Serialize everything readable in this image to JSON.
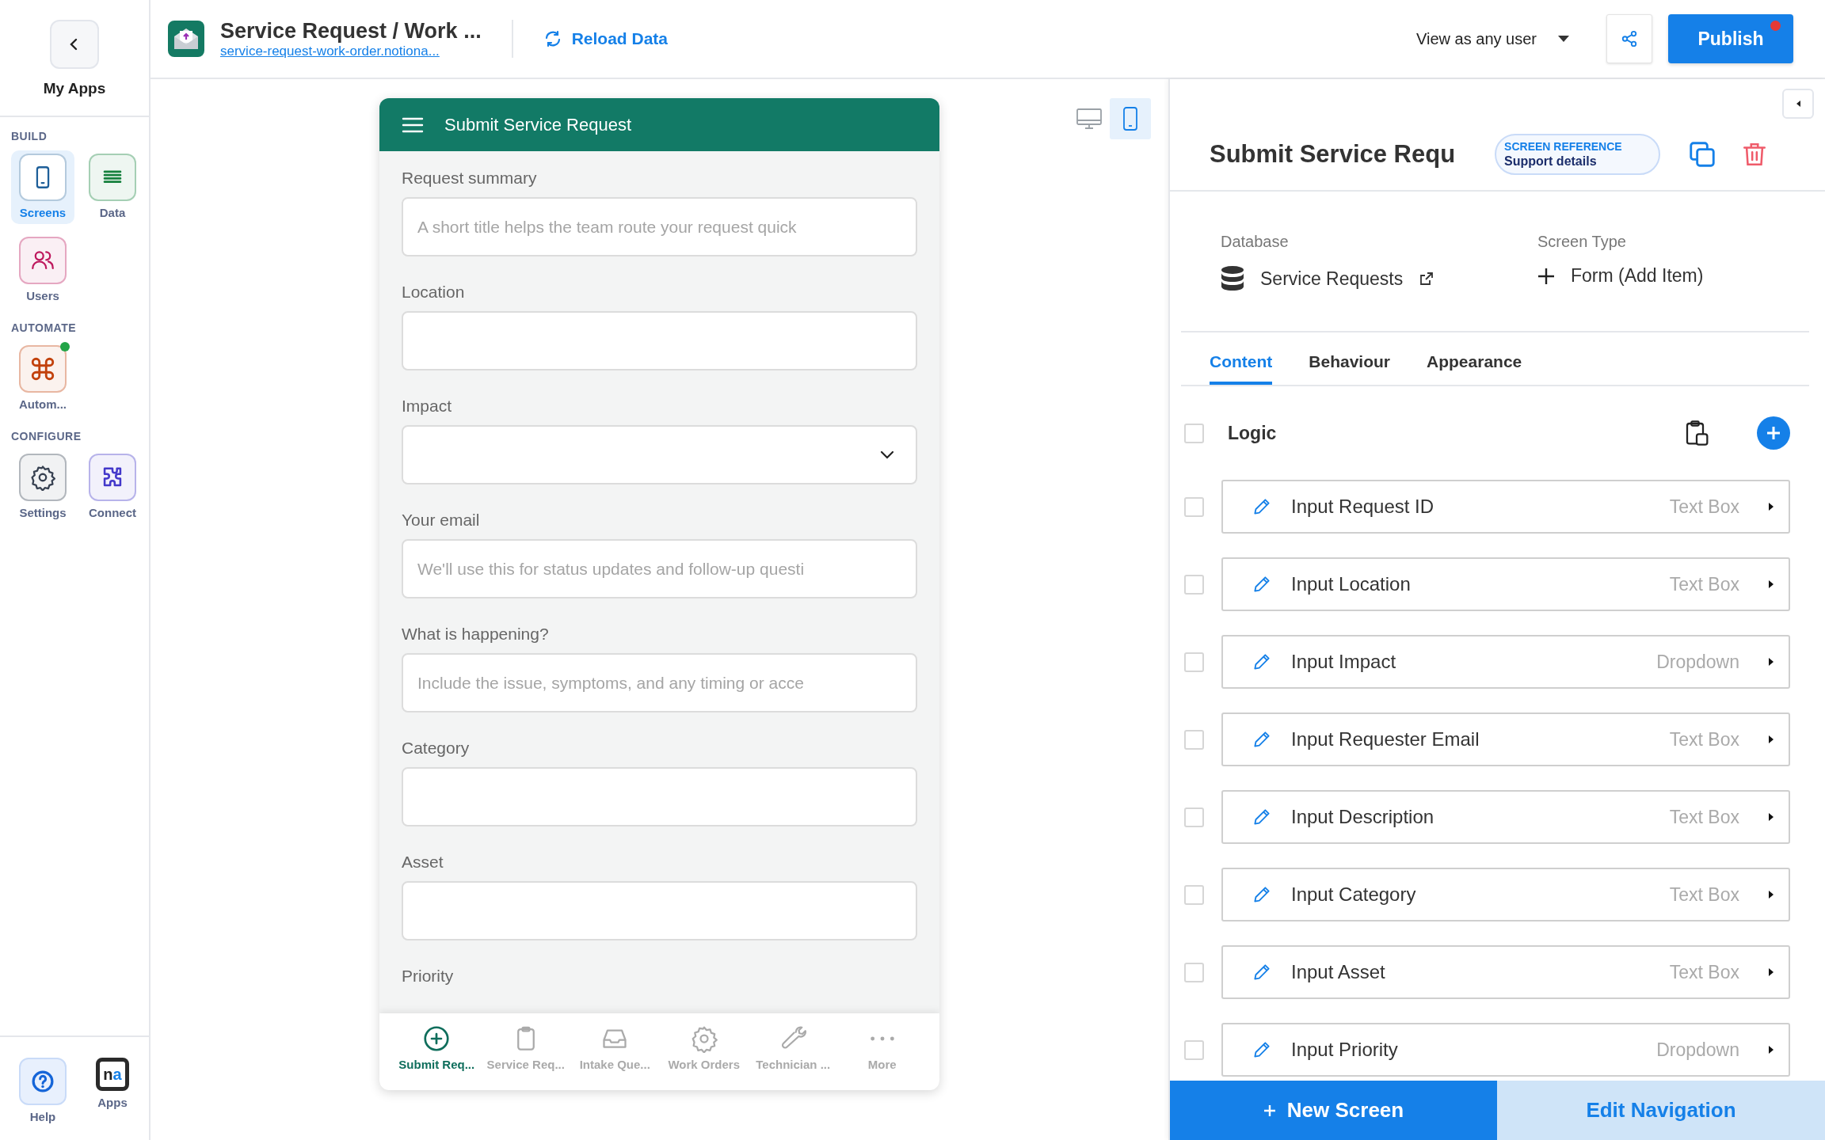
{
  "sidebar": {
    "back_label": "My Apps",
    "sections": [
      {
        "title": "BUILD",
        "items": [
          {
            "label": "Screens",
            "kind": "screens",
            "color": "#1e5f99",
            "selected": true,
            "notification": false
          },
          {
            "label": "Data",
            "kind": "data",
            "color": "#15803d",
            "selected": false,
            "notification": false
          },
          {
            "label": "Users",
            "kind": "users",
            "color": "#be185d",
            "selected": false,
            "notification": false
          }
        ]
      },
      {
        "title": "AUTOMATE",
        "items": [
          {
            "label": "Autom...",
            "kind": "automations",
            "color": "#c2410c",
            "selected": false,
            "notification": true
          }
        ]
      },
      {
        "title": "CONFIGURE",
        "items": [
          {
            "label": "Settings",
            "kind": "settings",
            "color": "#374151",
            "selected": false,
            "notification": false
          },
          {
            "label": "Connect",
            "kind": "connect",
            "color": "#4338ca",
            "selected": false,
            "notification": false
          }
        ]
      }
    ],
    "footer": [
      {
        "label": "Help",
        "kind": "help"
      },
      {
        "label": "Apps",
        "kind": "apps",
        "logo_text": "na"
      }
    ]
  },
  "top_bar": {
    "app_title": "Service Request / Work ...",
    "app_url": "service-request-work-order.notiona...",
    "reload": "Reload Data",
    "view_as": "View as any user",
    "publish": "Publish",
    "unpublished_changes": true
  },
  "canvas": {
    "devices": [
      {
        "kind": "desktop",
        "selected": false
      },
      {
        "kind": "mobile",
        "selected": true
      }
    ],
    "phone": {
      "title": "Submit Service Request",
      "fields": [
        {
          "label": "Request summary",
          "kind": "text",
          "placeholder": "A short title helps the team route your request quick"
        },
        {
          "label": "Location",
          "kind": "text"
        },
        {
          "label": "Impact",
          "kind": "dropdown"
        },
        {
          "label": "Your email",
          "kind": "text",
          "placeholder": "We'll use this for status updates and follow-up questi"
        },
        {
          "label": "What is happening?",
          "kind": "text",
          "placeholder": "Include the issue, symptoms, and any timing or acce"
        },
        {
          "label": "Category",
          "kind": "text"
        },
        {
          "label": "Asset",
          "kind": "text"
        },
        {
          "label": "Priority",
          "kind": "label"
        }
      ],
      "nav": [
        {
          "label": "Submit Req...",
          "kind": "plus",
          "selected": true
        },
        {
          "label": "Service Req...",
          "kind": "clipboard",
          "selected": false
        },
        {
          "label": "Intake Que...",
          "kind": "inbox",
          "selected": false
        },
        {
          "label": "Work Orders",
          "kind": "gear",
          "selected": false
        },
        {
          "label": "Technician ...",
          "kind": "wrench",
          "selected": false
        },
        {
          "label": "More",
          "kind": "more",
          "selected": false
        }
      ]
    }
  },
  "panel": {
    "title": "Submit Service Requ",
    "reference": {
      "label": "SCREEN REFERENCE",
      "value": "Support details"
    },
    "database": {
      "label": "Database",
      "value": "Service Requests"
    },
    "screen_type": {
      "label": "Screen Type",
      "value": "Form (Add Item)"
    },
    "tabs": [
      {
        "label": "Content",
        "selected": true
      },
      {
        "label": "Behaviour",
        "selected": false
      },
      {
        "label": "Appearance",
        "selected": false
      }
    ],
    "logic": {
      "label": "Logic",
      "checked": false
    },
    "components": [
      {
        "name": "Input Request ID",
        "type": "Text Box",
        "checked": false
      },
      {
        "name": "Input Location",
        "type": "Text Box",
        "checked": false
      },
      {
        "name": "Input Impact",
        "type": "Dropdown",
        "checked": false
      },
      {
        "name": "Input Requester Email",
        "type": "Text Box",
        "checked": false
      },
      {
        "name": "Input Description",
        "type": "Text Box",
        "checked": false
      },
      {
        "name": "Input Category",
        "type": "Text Box",
        "checked": false
      },
      {
        "name": "Input Asset",
        "type": "Text Box",
        "checked": false
      },
      {
        "name": "Input Priority",
        "type": "Dropdown",
        "checked": false
      }
    ],
    "buttons": {
      "new_screen": "New Screen",
      "edit_navigation": "Edit Navigation"
    }
  }
}
